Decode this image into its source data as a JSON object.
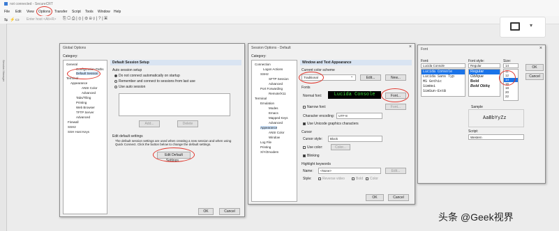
{
  "app": {
    "title": "not connected - SecureCRT",
    "menu": [
      "File",
      "Edit",
      "View",
      "Options",
      "Transfer",
      "Script",
      "Tools",
      "Window",
      "Help"
    ],
    "quick_hint": "Enter host <Alt+R>",
    "side_tab": "Session Manager"
  },
  "global_options": {
    "title": "Global Options",
    "category_label": "Category:",
    "tree": [
      "General",
      "Configuration Paths",
      "Default Session",
      "Terminal",
      "Appearance",
      "ANSI Color",
      "Advanced",
      "Tabs/Tiling",
      "Printing",
      "Web Browser",
      "TFTP Server",
      "Advanced",
      "Firewall",
      "SSH2",
      "SSH Host Keys"
    ],
    "panel_header": "Default Session Setup",
    "auto_session_label": "Auto session setup",
    "radio_1": "Do not connect automatically on startup",
    "radio_2": "Remember and connect to sessions from last use",
    "radio_3": "Use auto session",
    "add_label": "Add...",
    "delete_label": "Delete",
    "edit_default_label": "Edit default settings",
    "edit_default_text": "The default session settings are used when creating a new session and when using Quick Connect. Click the button below to change the default settings.",
    "edit_default_button": "Edit Default Settings...",
    "ok": "OK",
    "cancel": "Cancel"
  },
  "session_options": {
    "title": "Session Options - Default",
    "category_label": "Category:",
    "tree": [
      "Connection",
      "Logon Actions",
      "SSH2",
      "SFTP Session",
      "Advanced",
      "Port Forwarding",
      "Remote/X11",
      "Terminal",
      "Emulation",
      "Modes",
      "Emacs",
      "Mapped Keys",
      "Advanced",
      "Appearance",
      "ANSI Color",
      "Window",
      "Log File",
      "Printing",
      "X/Y/Zmodem"
    ],
    "panel_header": "Window and Text Appearance",
    "scheme_label": "Current color scheme",
    "scheme_value": "Traditional",
    "edit": "Edit...",
    "new": "New...",
    "fonts_label": "Fonts",
    "normal_font_label": "Normal font:",
    "font_preview": "Lucida Console",
    "font_button": "Font...",
    "narrow_font": "Narrow font:",
    "font_button2": "Font...",
    "encoding_label": "Character encoding:",
    "encoding_value": "UTF-8",
    "unicode_graphics": "Use Unicode graphics characters",
    "cursor_label": "Cursor",
    "cursor_style_label": "Cursor style:",
    "cursor_style_value": "Block",
    "use_color": "Use color:",
    "color_button": "Color...",
    "blinking": "Blinking",
    "highlight_label": "Highlight keywords",
    "name_label": "Name:",
    "name_value": "<None>",
    "edit2": "Edit...",
    "style_label": "Style:",
    "reverse_video": "Reverse video",
    "bold": "Bold",
    "color": "Color",
    "ok": "OK",
    "cancel": "Cancel"
  },
  "font_dialog": {
    "title": "Font",
    "font_label": "Font:",
    "font_value": "Lucida Console",
    "fonts": [
      "Lucida Console",
      "Lucida Sans Typ",
      "MS Gothic",
      "SimHei",
      "SimSun-ExtB"
    ],
    "style_label": "Font style:",
    "style_value": "Regular",
    "styles": [
      "Regular",
      "Oblique",
      "Bold",
      "Bold Obliq"
    ],
    "size_label": "Size:",
    "size_value": "14",
    "sizes": [
      "11",
      "12",
      "14",
      "16",
      "18",
      "20",
      "22"
    ],
    "ok": "OK",
    "cancel": "Cancel",
    "sample_label": "Sample",
    "sample_text": "AaBbYyZz",
    "script_label": "Script:",
    "script_value": "Western"
  },
  "watermark": "头条 @Geek视界"
}
